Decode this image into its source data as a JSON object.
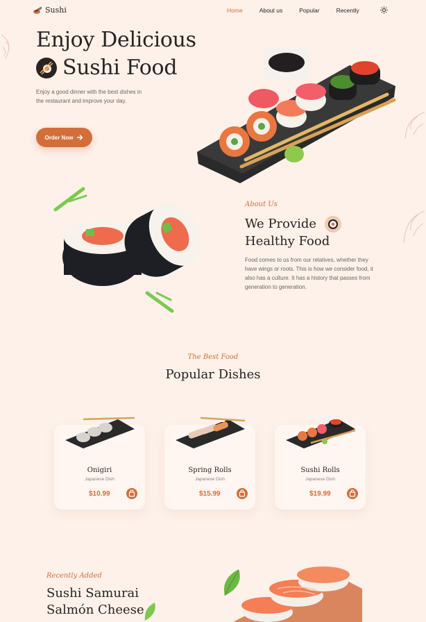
{
  "brand": {
    "name": "Sushi"
  },
  "nav": {
    "items": [
      {
        "label": "Home",
        "active": true
      },
      {
        "label": "About us",
        "active": false
      },
      {
        "label": "Popular",
        "active": false
      },
      {
        "label": "Recently",
        "active": false
      }
    ],
    "theme_icon": "sun-icon"
  },
  "hero": {
    "title_line1": "Enjoy Delicious",
    "title_line2": "Sushi Food",
    "description": "Enjoy a good dinner with the best dishes in the restaurant and improve your day.",
    "button_label": "Order Now",
    "button_icon": "arrow-right-icon"
  },
  "about": {
    "subtitle": "About Us",
    "title_line1": "We Provide",
    "title_line2": "Healthy Food",
    "description": "Food comes to us from our relatives, whether they have wings or roots. This is how we consider food, it also has a culture. It has a history that passes from generation to generation."
  },
  "popular": {
    "subtitle": "The Best Food",
    "title": "Popular Dishes",
    "dishes": [
      {
        "name": "Onigiri",
        "type": "Japanese Dish",
        "price": "$10.99"
      },
      {
        "name": "Spring Rolls",
        "type": "Japanese Dish",
        "price": "$15.99"
      },
      {
        "name": "Sushi Rolls",
        "type": "Japanese Dish",
        "price": "$19.99"
      }
    ]
  },
  "recent": {
    "subtitle": "Recently Added",
    "title_line1": "Sushi Samurai",
    "title_line2": "Salmón Cheese"
  },
  "colors": {
    "background": "#fdf1ea",
    "accent": "#d36e3b",
    "text": "#2a2321",
    "muted": "#6d6460"
  }
}
